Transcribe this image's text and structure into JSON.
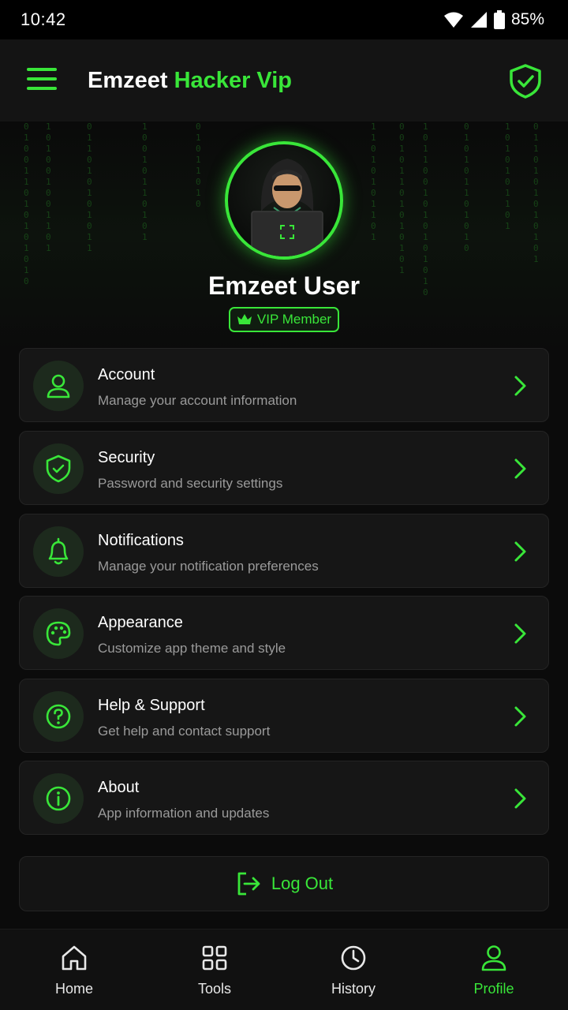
{
  "status_bar": {
    "time": "10:42",
    "battery": "85%"
  },
  "app_bar": {
    "title_main": "Emzeet",
    "title_accent": "Hacker Vip"
  },
  "profile": {
    "name": "Emzeet User",
    "badge": "VIP Member"
  },
  "menu": [
    {
      "title": "Account",
      "subtitle": "Manage your account information",
      "icon": "user-icon"
    },
    {
      "title": "Security",
      "subtitle": "Password and security settings",
      "icon": "shield-check-icon"
    },
    {
      "title": "Notifications",
      "subtitle": "Manage your notification preferences",
      "icon": "bell-icon"
    },
    {
      "title": "Appearance",
      "subtitle": "Customize app theme and style",
      "icon": "palette-icon"
    },
    {
      "title": "Help & Support",
      "subtitle": "Get help and contact support",
      "icon": "help-circle-icon"
    },
    {
      "title": "About",
      "subtitle": "App information and updates",
      "icon": "info-icon"
    }
  ],
  "logout": {
    "label": "Log Out"
  },
  "bottom_nav": [
    {
      "label": "Home",
      "icon": "home-icon",
      "active": false
    },
    {
      "label": "Tools",
      "icon": "grid-icon",
      "active": false
    },
    {
      "label": "History",
      "icon": "clock-icon",
      "active": false
    },
    {
      "label": "Profile",
      "icon": "user-icon",
      "active": true
    }
  ],
  "colors": {
    "accent": "#39e639",
    "background": "#0b0b0b",
    "card": "#161616",
    "subtext": "#9a9a9a"
  }
}
